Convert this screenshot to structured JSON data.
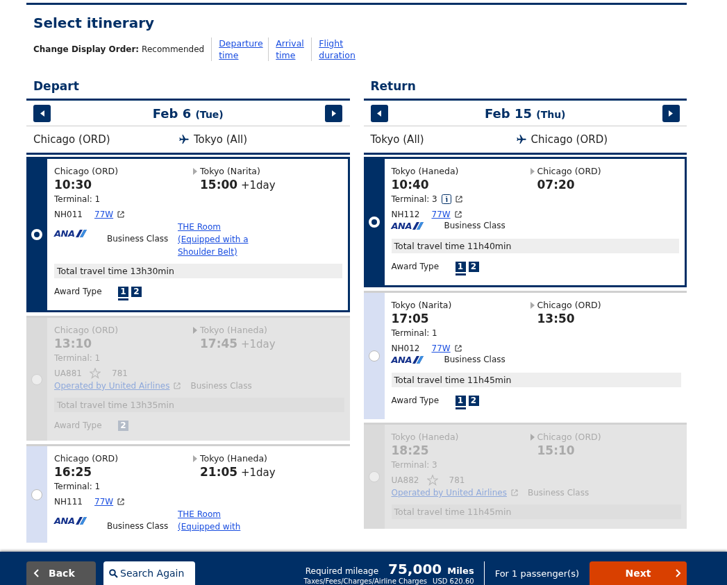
{
  "title": "Select itinerary",
  "display_order": {
    "label": "Change Display Order:",
    "current": "Recommended",
    "options": [
      {
        "label": "Departure time"
      },
      {
        "label": "Arrival time"
      },
      {
        "label": "Flight duration"
      }
    ]
  },
  "columns": [
    {
      "heading": "Depart",
      "date": "Feb 6",
      "weekday": "(Tue)",
      "from": "Chicago (ORD)",
      "to": "Tokyo (All)",
      "flights": [
        {
          "kind": "ana",
          "selected": true,
          "disabled": false,
          "from": "Chicago (ORD)",
          "dep_time": "10:30",
          "to": "Tokyo (Narita)",
          "arr_time": "15:00",
          "arr_plus": "+1day",
          "terminal": "Terminal: 1",
          "terminal_info": false,
          "flight_no": "NH011",
          "aircraft": "77W",
          "carrier_logo": "ANA",
          "cabin": "Business Class",
          "seat_link": "THE Room (Equipped with a Shoulder Belt)",
          "total": "Total travel time 13h30min",
          "award_label": "Award Type",
          "awards": [
            {
              "label": "1",
              "selected": true
            },
            {
              "label": "2",
              "selected": false
            }
          ]
        },
        {
          "kind": "partner",
          "selected": false,
          "disabled": true,
          "from": "Chicago (ORD)",
          "dep_time": "13:10",
          "to": "Tokyo (Haneda)",
          "arr_time": "17:45",
          "arr_plus": "+1day",
          "terminal": "Terminal: 1",
          "terminal_info": false,
          "flight_no": "UA881",
          "aircraft": "781",
          "operated_by": "Operated by United Airlines",
          "cabin": "Business Class",
          "total": "Total travel time 13h35min",
          "award_label": "Award Type",
          "awards": [
            {
              "label": "2",
              "selected": false
            }
          ]
        },
        {
          "kind": "ana",
          "selected": false,
          "disabled": false,
          "from": "Chicago (ORD)",
          "dep_time": "16:25",
          "to": "Tokyo (Haneda)",
          "arr_time": "21:05",
          "arr_plus": "+1day",
          "terminal": "Terminal: 1",
          "terminal_info": false,
          "flight_no": "NH111",
          "aircraft": "77W",
          "carrier_logo": "ANA",
          "cabin": "Business Class",
          "seat_link": "THE Room (Equipped with"
        }
      ]
    },
    {
      "heading": "Return",
      "date": "Feb 15",
      "weekday": "(Thu)",
      "from": "Tokyo (All)",
      "to": "Chicago (ORD)",
      "flights": [
        {
          "kind": "ana",
          "selected": true,
          "disabled": false,
          "from": "Tokyo (Haneda)",
          "dep_time": "10:40",
          "to": "Chicago (ORD)",
          "arr_time": "07:20",
          "terminal": "Terminal: 3",
          "terminal_info": true,
          "flight_no": "NH112",
          "aircraft": "77W",
          "carrier_logo": "ANA",
          "cabin": "Business Class",
          "total": "Total travel time 11h40min",
          "award_label": "Award Type",
          "awards": [
            {
              "label": "1",
              "selected": true
            },
            {
              "label": "2",
              "selected": false
            }
          ]
        },
        {
          "kind": "ana",
          "selected": false,
          "disabled": false,
          "from": "Tokyo (Narita)",
          "dep_time": "17:05",
          "to": "Chicago (ORD)",
          "arr_time": "13:50",
          "terminal": "Terminal: 1",
          "terminal_info": false,
          "flight_no": "NH012",
          "aircraft": "77W",
          "carrier_logo": "ANA",
          "cabin": "Business Class",
          "total": "Total travel time 11h45min",
          "award_label": "Award Type",
          "awards": [
            {
              "label": "1",
              "selected": true
            },
            {
              "label": "2",
              "selected": false
            }
          ]
        },
        {
          "kind": "partner",
          "selected": false,
          "disabled": true,
          "from": "Tokyo (Haneda)",
          "dep_time": "18:25",
          "to": "Chicago (ORD)",
          "arr_time": "15:10",
          "terminal": "Terminal: 3",
          "terminal_info": false,
          "flight_no": "UA882",
          "aircraft": "781",
          "operated_by": "Operated by United Airlines",
          "cabin": "Business Class",
          "total": "Total travel time 11h45min"
        }
      ]
    }
  ],
  "footer": {
    "back": "Back",
    "search_again": "Search Again",
    "mileage_label": "Required mileage",
    "mileage": "75,000",
    "mileage_unit": "Miles",
    "taxes_label": "Taxes/Fees/Charges/Airline Charges",
    "taxes": "USD 620.60",
    "passengers": "For 1 passenger(s)",
    "next": "Next"
  }
}
